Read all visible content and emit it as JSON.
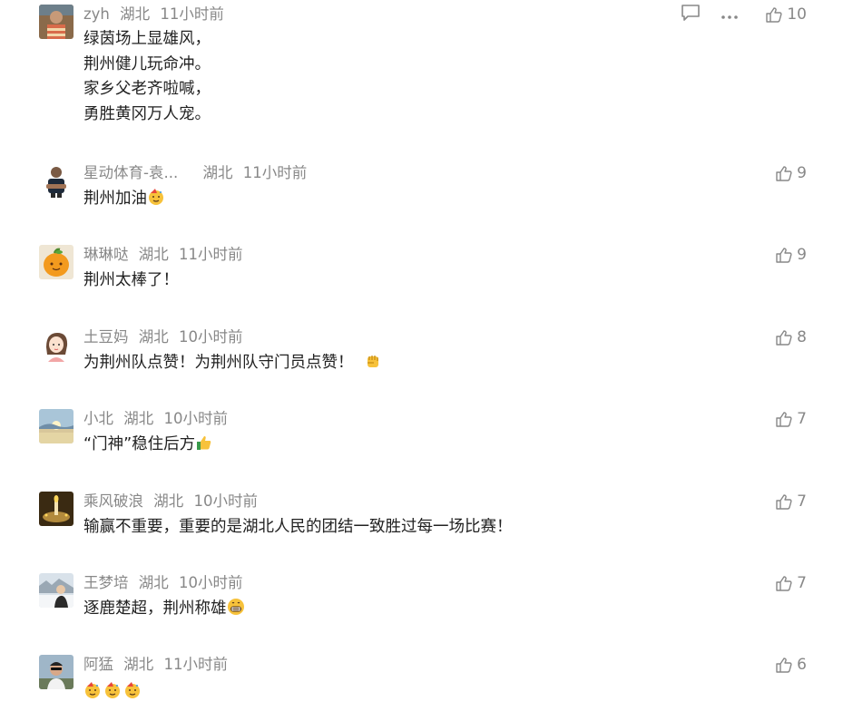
{
  "comments": [
    {
      "user": "zyh",
      "region": "湖北",
      "time": "11小时前",
      "lines": [
        "绿茵场上显雄风，",
        "荆州健儿玩命冲。",
        "家乡父老齐啦喊，",
        "勇胜黄冈万人宠。"
      ],
      "likes": "10",
      "avatar": "person-in-stripes"
    },
    {
      "user": "星动体育-袁...",
      "region": "湖北",
      "time": "11小时前",
      "lines": [
        "荆州加油"
      ],
      "emoji": [
        "party-face"
      ],
      "likes": "9",
      "avatar": "man-arms-crossed"
    },
    {
      "user": "琳琳哒",
      "region": "湖北",
      "time": "11小时前",
      "lines": [
        "荆州太棒了！"
      ],
      "likes": "9",
      "avatar": "orange-fruit"
    },
    {
      "user": "土豆妈",
      "region": "湖北",
      "time": "10小时前",
      "lines": [
        "为荆州队点赞！为荆州队守门员点赞！"
      ],
      "emoji": [
        "raised-fist"
      ],
      "likes": "8",
      "avatar": "cartoon-girl"
    },
    {
      "user": "小北",
      "region": "湖北",
      "time": "10小时前",
      "lines": [
        "“门神”稳住后方"
      ],
      "emoji": [
        "thumbs-up"
      ],
      "likes": "7",
      "avatar": "lake-sunrise"
    },
    {
      "user": "乘风破浪",
      "region": "湖北",
      "time": "10小时前",
      "lines": [
        "输赢不重要，重要的是湖北人民的团结一致胜过每一场比赛！"
      ],
      "likes": "7",
      "avatar": "candle-light"
    },
    {
      "user": "王梦培",
      "region": "湖北",
      "time": "10小时前",
      "lines": [
        "逐鹿楚超，荆州称雄"
      ],
      "emoji": [
        "grinning-face"
      ],
      "likes": "7",
      "avatar": "person-snow"
    },
    {
      "user": "阿猛",
      "region": "湖北",
      "time": "11小时前",
      "lines": [
        ""
      ],
      "emoji": [
        "party-face",
        "party-face",
        "party-face"
      ],
      "likes": "6",
      "avatar": "man-sunglasses"
    }
  ],
  "icons": {
    "reply": "comment-icon",
    "more": "more-icon",
    "like": "thumbs-up-icon"
  },
  "colors": {
    "meta": "#888888",
    "text": "#222222"
  }
}
